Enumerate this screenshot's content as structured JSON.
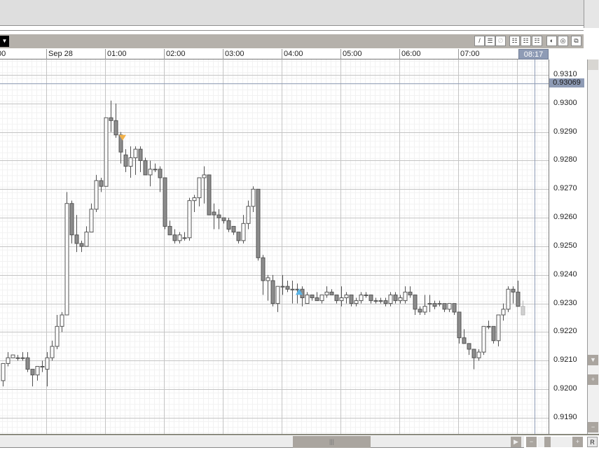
{
  "toolbar": {
    "dropdown_icon": "▼",
    "buttons": [
      {
        "name": "draw-line-button",
        "glyph": "/"
      },
      {
        "name": "hline-button",
        "glyph": "☰"
      },
      {
        "name": "clear-button",
        "glyph": "∅"
      },
      {
        "name": "grid1-button",
        "glyph": "☷"
      },
      {
        "name": "grid2-button",
        "glyph": "☷"
      },
      {
        "name": "grid3-button",
        "glyph": "☷"
      },
      {
        "name": "theme1-button",
        "glyph": "◐"
      },
      {
        "name": "theme2-button",
        "glyph": "◎"
      },
      {
        "name": "popout-button",
        "glyph": "⧉"
      }
    ]
  },
  "time_axis": {
    "labels": [
      "00",
      "Sep 28",
      "01:00",
      "02:00",
      "03:00",
      "04:00",
      "05:00",
      "06:00",
      "07:00"
    ],
    "current_time": "08:17"
  },
  "price_axis": {
    "labels": [
      "0.9310",
      "0.9300",
      "0.9290",
      "0.9280",
      "0.9270",
      "0.9260",
      "0.9250",
      "0.9240",
      "0.9230",
      "0.9220",
      "0.9210",
      "0.9200",
      "0.9190"
    ],
    "current_price": "0.93069"
  },
  "scroll": {
    "reset_label": "R",
    "plus": "+",
    "minus": "−"
  },
  "colors": {
    "bear": "#8c8c8c",
    "bull": "#ffffff",
    "live": "#d0d0d0",
    "marker_sell": "#f2b24a",
    "marker_buy": "#5ab4e6",
    "current_line": "#8e9bb5"
  },
  "chart_data": {
    "type": "candlestick",
    "interval": "5 min",
    "ylim": [
      0.9185,
      0.9315
    ],
    "current_price": 0.93069,
    "markers": [
      {
        "index": 24,
        "type": "sell"
      },
      {
        "index": 60,
        "type": "buy"
      }
    ],
    "ohlc": [
      [
        0.9203,
        0.9209,
        0.9201,
        0.9209
      ],
      [
        0.9209,
        0.9213,
        0.9208,
        0.9211
      ],
      [
        0.9211,
        0.9212,
        0.9211,
        0.9212
      ],
      [
        0.9211,
        0.9212,
        0.921,
        0.9211
      ],
      [
        0.9211,
        0.9213,
        0.921,
        0.9211
      ],
      [
        0.9211,
        0.9213,
        0.9206,
        0.9207
      ],
      [
        0.9207,
        0.9207,
        0.9201,
        0.9205
      ],
      [
        0.9205,
        0.9208,
        0.9203,
        0.9208
      ],
      [
        0.9208,
        0.921,
        0.9206,
        0.9208
      ],
      [
        0.9207,
        0.9213,
        0.9201,
        0.9211
      ],
      [
        0.9211,
        0.9217,
        0.921,
        0.9215
      ],
      [
        0.9215,
        0.9226,
        0.9214,
        0.9222
      ],
      [
        0.9222,
        0.9227,
        0.922,
        0.9226
      ],
      [
        0.9226,
        0.9269,
        0.9226,
        0.9265
      ],
      [
        0.9265,
        0.9266,
        0.9251,
        0.9254
      ],
      [
        0.9254,
        0.9261,
        0.9248,
        0.9251
      ],
      [
        0.9251,
        0.9252,
        0.9248,
        0.925
      ],
      [
        0.925,
        0.9257,
        0.925,
        0.9255
      ],
      [
        0.9255,
        0.9265,
        0.9255,
        0.9263
      ],
      [
        0.9263,
        0.9275,
        0.9262,
        0.9273
      ],
      [
        0.9273,
        0.9274,
        0.9269,
        0.9271
      ],
      [
        0.9271,
        0.9295,
        0.9271,
        0.9295
      ],
      [
        0.9295,
        0.9301,
        0.929,
        0.9294
      ],
      [
        0.9294,
        0.93,
        0.9288,
        0.9289
      ],
      [
        0.9289,
        0.929,
        0.9279,
        0.9283
      ],
      [
        0.9282,
        0.9284,
        0.9276,
        0.9278
      ],
      [
        0.9278,
        0.9285,
        0.9274,
        0.9281
      ],
      [
        0.9281,
        0.9285,
        0.9275,
        0.9284
      ],
      [
        0.9284,
        0.9285,
        0.9276,
        0.928
      ],
      [
        0.928,
        0.9281,
        0.9275,
        0.9275
      ],
      [
        0.9275,
        0.928,
        0.9271,
        0.9277
      ],
      [
        0.9277,
        0.9279,
        0.9276,
        0.9277
      ],
      [
        0.9277,
        0.9278,
        0.9269,
        0.9274
      ],
      [
        0.9274,
        0.9274,
        0.9256,
        0.9257
      ],
      [
        0.9257,
        0.9259,
        0.9254,
        0.9254
      ],
      [
        0.9254,
        0.9256,
        0.9251,
        0.9252
      ],
      [
        0.9252,
        0.9255,
        0.9251,
        0.9254
      ],
      [
        0.9253,
        0.9255,
        0.9252,
        0.9253
      ],
      [
        0.9253,
        0.9267,
        0.9252,
        0.9266
      ],
      [
        0.9266,
        0.9268,
        0.9262,
        0.9267
      ],
      [
        0.9267,
        0.9274,
        0.9264,
        0.9274
      ],
      [
        0.9274,
        0.9278,
        0.9265,
        0.9275
      ],
      [
        0.9275,
        0.9275,
        0.9261,
        0.9261
      ],
      [
        0.9262,
        0.9265,
        0.9256,
        0.9261
      ],
      [
        0.9261,
        0.9263,
        0.9256,
        0.926
      ],
      [
        0.926,
        0.926,
        0.9258,
        0.9259
      ],
      [
        0.9259,
        0.926,
        0.9255,
        0.9256
      ],
      [
        0.9257,
        0.9257,
        0.9254,
        0.9255
      ],
      [
        0.9255,
        0.9255,
        0.9251,
        0.9252
      ],
      [
        0.9252,
        0.9261,
        0.9251,
        0.9258
      ],
      [
        0.9258,
        0.9266,
        0.9256,
        0.9264
      ],
      [
        0.9264,
        0.9271,
        0.9262,
        0.927
      ],
      [
        0.927,
        0.927,
        0.9245,
        0.9246
      ],
      [
        0.9246,
        0.9247,
        0.9233,
        0.9238
      ],
      [
        0.9238,
        0.924,
        0.9231,
        0.9239
      ],
      [
        0.9238,
        0.924,
        0.9229,
        0.923
      ],
      [
        0.923,
        0.9236,
        0.9227,
        0.9236
      ],
      [
        0.9236,
        0.924,
        0.9233,
        0.9236
      ],
      [
        0.9236,
        0.9238,
        0.9234,
        0.9235
      ],
      [
        0.9235,
        0.9238,
        0.923,
        0.9235
      ],
      [
        0.9235,
        0.9237,
        0.923,
        0.9235
      ],
      [
        0.9235,
        0.9236,
        0.9229,
        0.9232
      ],
      [
        0.923,
        0.9234,
        0.923,
        0.9233
      ],
      [
        0.9233,
        0.9233,
        0.9231,
        0.9232
      ],
      [
        0.9232,
        0.9234,
        0.9231,
        0.9231
      ],
      [
        0.9231,
        0.9233,
        0.923,
        0.9233
      ],
      [
        0.9233,
        0.9236,
        0.9232,
        0.9234
      ],
      [
        0.9234,
        0.9235,
        0.9233,
        0.9233
      ],
      [
        0.9233,
        0.9233,
        0.923,
        0.9231
      ],
      [
        0.9231,
        0.9236,
        0.9229,
        0.9232
      ],
      [
        0.9232,
        0.9234,
        0.923,
        0.9233
      ],
      [
        0.9233,
        0.9233,
        0.9229,
        0.923
      ],
      [
        0.923,
        0.9232,
        0.9229,
        0.9231
      ],
      [
        0.9231,
        0.9234,
        0.923,
        0.9233
      ],
      [
        0.9233,
        0.9234,
        0.9232,
        0.9233
      ],
      [
        0.9233,
        0.9233,
        0.923,
        0.9231
      ],
      [
        0.9231,
        0.9232,
        0.923,
        0.9231
      ],
      [
        0.9231,
        0.9232,
        0.923,
        0.9231
      ],
      [
        0.9231,
        0.9232,
        0.9229,
        0.923
      ],
      [
        0.923,
        0.9234,
        0.9229,
        0.9233
      ],
      [
        0.9233,
        0.9234,
        0.923,
        0.9231
      ],
      [
        0.9231,
        0.9233,
        0.923,
        0.9232
      ],
      [
        0.9231,
        0.9236,
        0.923,
        0.9234
      ],
      [
        0.9234,
        0.9236,
        0.9232,
        0.9233
      ],
      [
        0.9233,
        0.9233,
        0.9226,
        0.9228
      ],
      [
        0.9228,
        0.9229,
        0.9226,
        0.9227
      ],
      [
        0.9227,
        0.9233,
        0.9226,
        0.9229
      ],
      [
        0.923,
        0.9233,
        0.9227,
        0.923
      ],
      [
        0.923,
        0.9231,
        0.9228,
        0.9229
      ],
      [
        0.923,
        0.9231,
        0.9229,
        0.923
      ],
      [
        0.923,
        0.923,
        0.9227,
        0.9228
      ],
      [
        0.9228,
        0.923,
        0.9227,
        0.923
      ],
      [
        0.923,
        0.923,
        0.9226,
        0.9227
      ],
      [
        0.9227,
        0.9227,
        0.9216,
        0.9218
      ],
      [
        0.9218,
        0.9221,
        0.9216,
        0.9216
      ],
      [
        0.9216,
        0.9216,
        0.9212,
        0.9214
      ],
      [
        0.9214,
        0.9214,
        0.9207,
        0.9211
      ],
      [
        0.9211,
        0.9214,
        0.921,
        0.9213
      ],
      [
        0.9213,
        0.9222,
        0.9212,
        0.9222
      ],
      [
        0.9222,
        0.9224,
        0.9221,
        0.9222
      ],
      [
        0.9222,
        0.9222,
        0.9216,
        0.9217
      ],
      [
        0.9217,
        0.9226,
        0.9215,
        0.9226
      ],
      [
        0.9226,
        0.923,
        0.9224,
        0.9228
      ],
      [
        0.9228,
        0.9236,
        0.9227,
        0.9235
      ],
      [
        0.9235,
        0.9236,
        0.923,
        0.9234
      ],
      [
        0.9234,
        0.9238,
        0.9229,
        0.9229
      ],
      [
        0.9229,
        0.9231,
        0.9226,
        0.9226
      ]
    ]
  }
}
